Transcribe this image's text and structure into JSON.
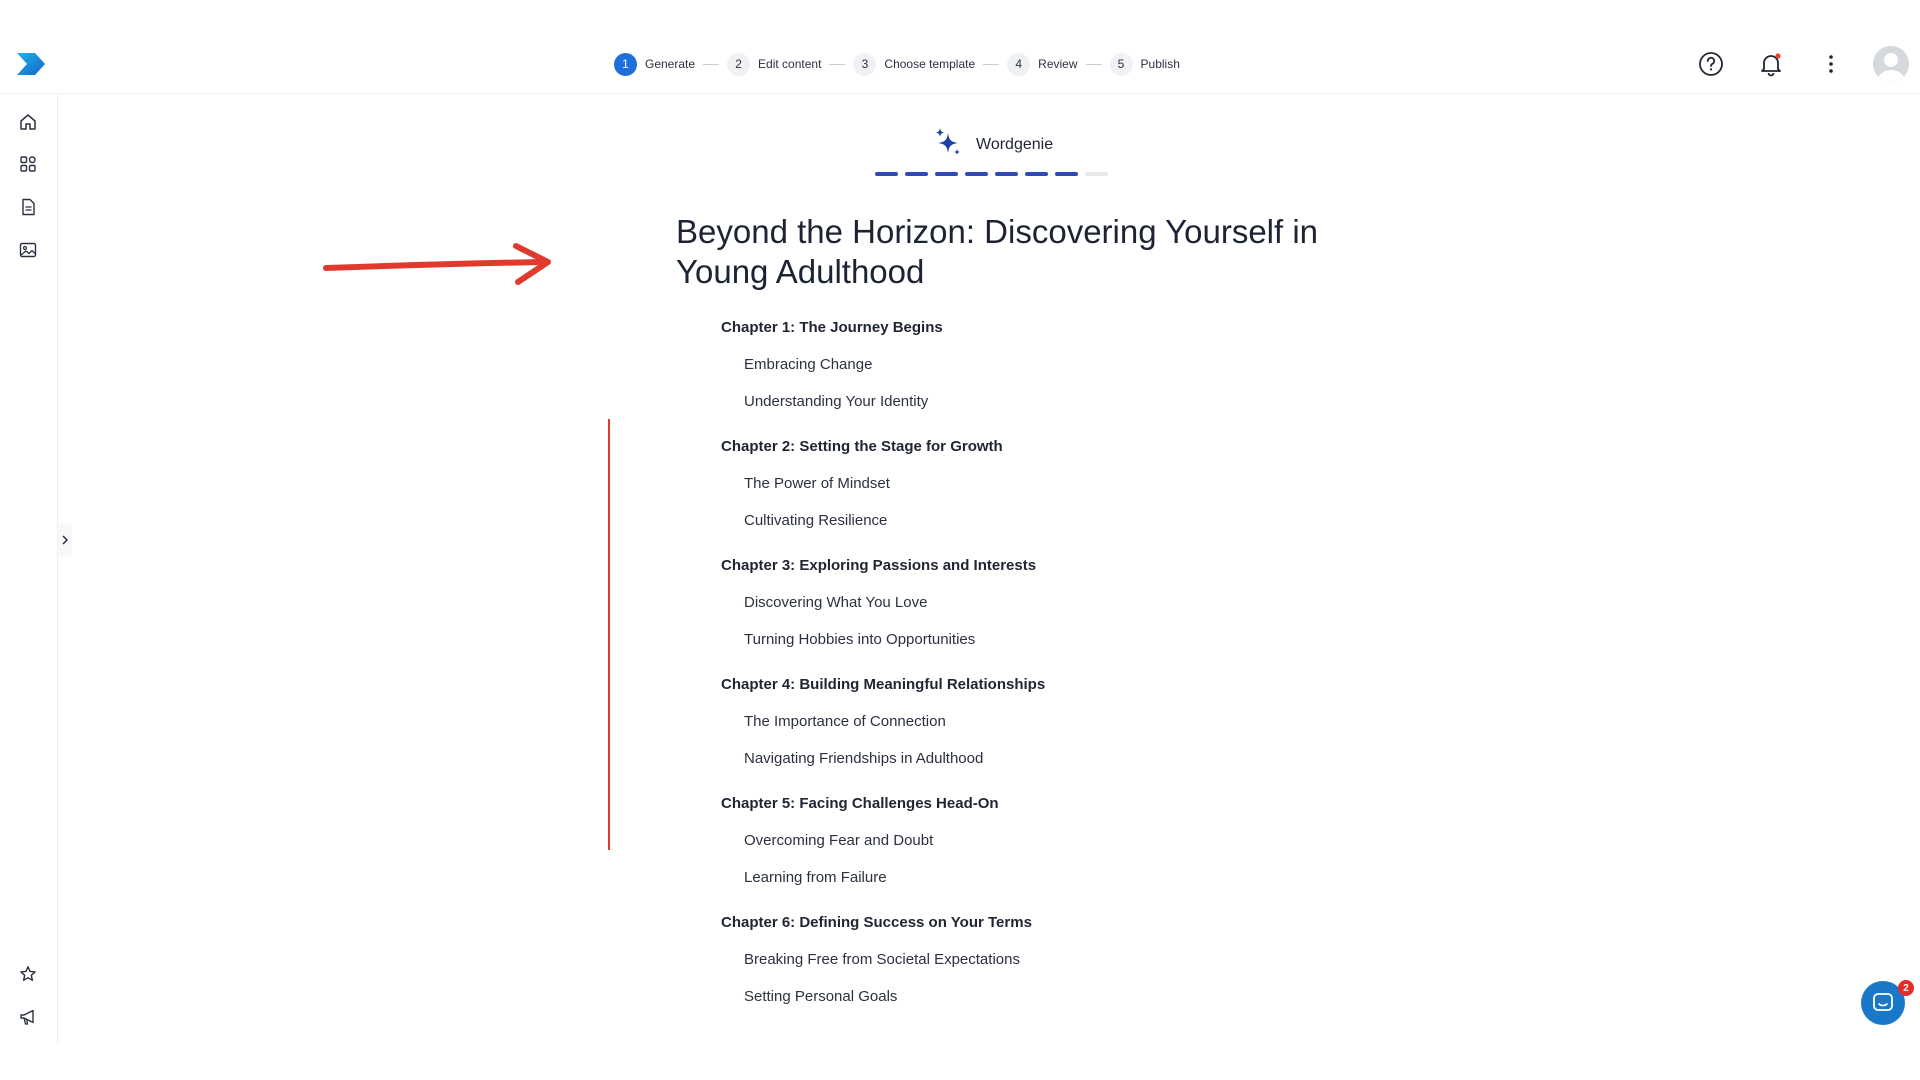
{
  "stepper": {
    "steps": [
      {
        "number": "1",
        "label": "Generate"
      },
      {
        "number": "2",
        "label": "Edit content"
      },
      {
        "number": "3",
        "label": "Choose template"
      },
      {
        "number": "4",
        "label": "Review"
      },
      {
        "number": "5",
        "label": "Publish"
      }
    ],
    "active_step": 1
  },
  "header_icons": [
    "help-icon",
    "bell-icon",
    "more-vertical-icon",
    "avatar"
  ],
  "sidebar": {
    "items": [
      "home-icon",
      "apps-grid-icon",
      "document-icon",
      "image-icon"
    ],
    "bottom_items": [
      "star-icon",
      "megaphone-icon"
    ]
  },
  "generator": {
    "label": "Wordgenie",
    "progress_completed": 7,
    "progress_total": 8
  },
  "document": {
    "title": "Beyond the Horizon: Discovering Yourself in Young Adulthood",
    "chapters": [
      {
        "title": "Chapter 1: The Journey Begins",
        "sections": [
          "Embracing Change",
          "Understanding Your Identity"
        ]
      },
      {
        "title": "Chapter 2: Setting the Stage for Growth",
        "sections": [
          "The Power of Mindset",
          "Cultivating Resilience"
        ]
      },
      {
        "title": "Chapter 3: Exploring Passions and Interests",
        "sections": [
          "Discovering What You Love",
          "Turning Hobbies into Opportunities"
        ]
      },
      {
        "title": "Chapter 4: Building Meaningful Relationships",
        "sections": [
          "The Importance of Connection",
          "Navigating Friendships in Adulthood"
        ]
      },
      {
        "title": "Chapter 5: Facing Challenges Head-On",
        "sections": [
          "Overcoming Fear and Doubt",
          "Learning from Failure"
        ]
      },
      {
        "title": "Chapter 6: Defining Success on Your Terms",
        "sections": [
          "Breaking Free from Societal Expectations",
          "Setting Personal Goals"
        ]
      }
    ]
  },
  "chat": {
    "badge_count": "2"
  },
  "colors": {
    "accent": "#1e6fd9",
    "progress": "#2f49b6",
    "annotation": "#e03a2f",
    "chat": "#1a78c9"
  }
}
